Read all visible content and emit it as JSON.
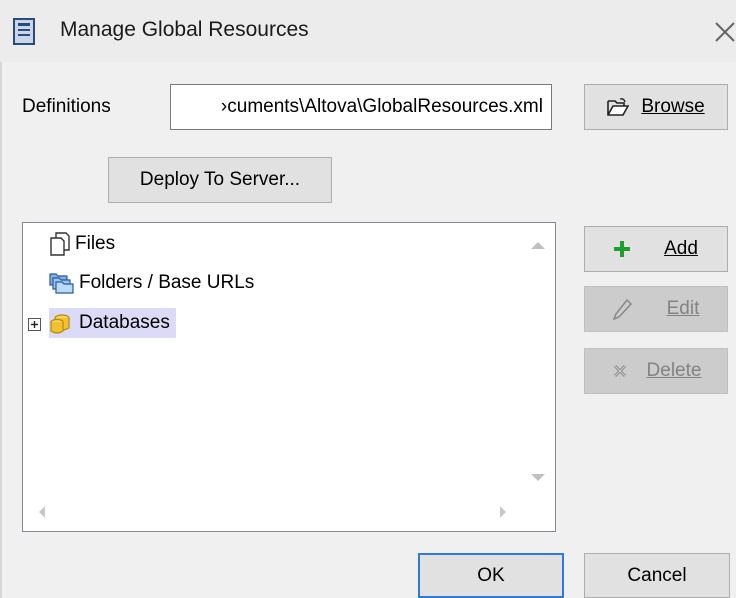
{
  "window": {
    "title": "Manage Global Resources",
    "icon": "dialog-icon",
    "close_icon": "close-icon"
  },
  "definitions": {
    "label": "Definitions",
    "path_value": "Documents\\Altova\\GlobalResources.xml",
    "path_visible": "›cuments\\Altova\\GlobalResources.xml"
  },
  "buttons": {
    "browse": {
      "label": "Browse",
      "icon": "open-folder-icon"
    },
    "deploy": {
      "label": "Deploy To Server..."
    },
    "add": {
      "label": "Add",
      "icon": "plus-icon"
    },
    "edit": {
      "label": "Edit",
      "icon": "pencil-icon",
      "enabled": false
    },
    "delete": {
      "label": "Delete",
      "icon": "delete-icon",
      "enabled": false
    },
    "ok": {
      "label": "OK"
    },
    "cancel": {
      "label": "Cancel"
    }
  },
  "tree": {
    "items": [
      {
        "label": "Files",
        "icon": "files-icon",
        "expandable": false,
        "selected": false
      },
      {
        "label": "Folders / Base URLs",
        "icon": "folders-icon",
        "expandable": false,
        "selected": false
      },
      {
        "label": "Databases",
        "icon": "database-icon",
        "expandable": true,
        "selected": true
      }
    ]
  },
  "colors": {
    "selection": "#dbdbf7",
    "default_button_border": "#2f7ad3",
    "add_icon": "#1e9e2a",
    "database_icon": "#f2c12e"
  }
}
